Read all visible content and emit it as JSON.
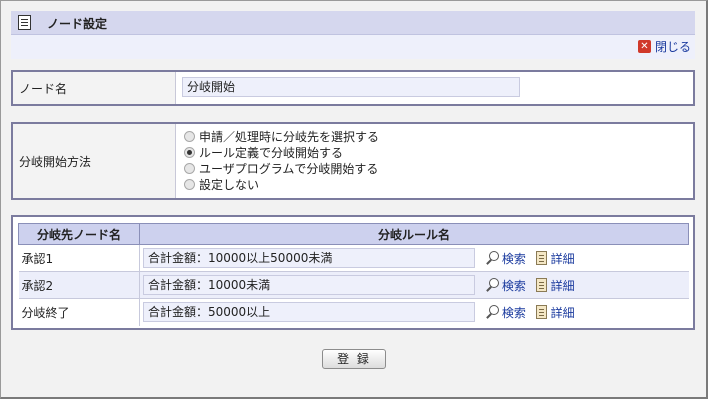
{
  "dialog": {
    "title": "ノード設定",
    "close_label": "閉じる"
  },
  "node_name": {
    "label": "ノード名",
    "value": "分岐開始"
  },
  "branch_method": {
    "label": "分岐開始方法",
    "options": [
      {
        "label": "申請／処理時に分岐先を選択する",
        "selected": false
      },
      {
        "label": "ルール定義で分岐開始する",
        "selected": true
      },
      {
        "label": "ユーザプログラムで分岐開始する",
        "selected": false
      },
      {
        "label": "設定しない",
        "selected": false
      }
    ]
  },
  "rules_table": {
    "headers": [
      "分岐先ノード名",
      "分岐ルール名"
    ],
    "search_label": "検索",
    "detail_label": "詳細",
    "rows": [
      {
        "node": "承認1",
        "rule": "合計金額：10000以上50000未満"
      },
      {
        "node": "承認2",
        "rule": "合計金額：10000未満"
      },
      {
        "node": "分岐終了",
        "rule": "合計金額：50000以上"
      }
    ]
  },
  "register_label": "登 録"
}
